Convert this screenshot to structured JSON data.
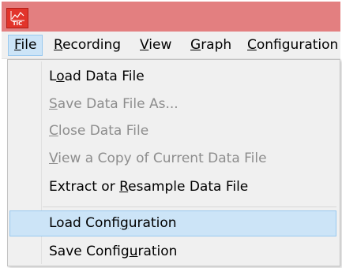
{
  "app": {
    "icon_name": "chart-app-icon",
    "icon_label": "TIC",
    "titlebar_color": "#e37f80"
  },
  "menubar": {
    "items": [
      {
        "pre": "",
        "mn": "F",
        "post": "ile",
        "active": true
      },
      {
        "pre": "",
        "mn": "R",
        "post": "ecording",
        "active": false
      },
      {
        "pre": "",
        "mn": "V",
        "post": "iew",
        "active": false
      },
      {
        "pre": "",
        "mn": "G",
        "post": "raph",
        "active": false
      },
      {
        "pre": "",
        "mn": "C",
        "post": "onfiguration",
        "active": false
      }
    ]
  },
  "file_menu": {
    "items": [
      {
        "pre": "L",
        "mn": "o",
        "post": "ad Data File",
        "enabled": true,
        "highlighted": false
      },
      {
        "pre": "",
        "mn": "S",
        "post": "ave Data File As...",
        "enabled": false,
        "highlighted": false
      },
      {
        "pre": "",
        "mn": "C",
        "post": "lose Data File",
        "enabled": false,
        "highlighted": false
      },
      {
        "pre": "",
        "mn": "V",
        "post": "iew a Copy of Current Data File",
        "enabled": false,
        "highlighted": false
      },
      {
        "pre": "Extract or ",
        "mn": "R",
        "post": "esample Data File",
        "enabled": true,
        "highlighted": false
      },
      {
        "pre": "Load Confi",
        "mn": "g",
        "post": "uration",
        "enabled": true,
        "highlighted": true
      },
      {
        "pre": "Save Config",
        "mn": "u",
        "post": "ration",
        "enabled": true,
        "highlighted": false
      }
    ]
  }
}
